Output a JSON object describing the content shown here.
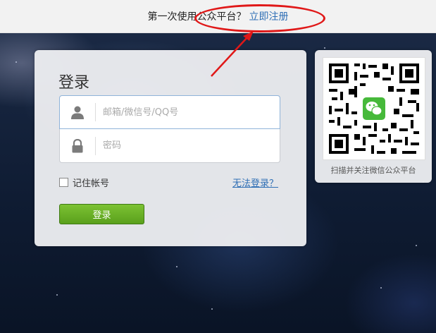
{
  "header": {
    "prompt": "第一次使用公众平台？",
    "register_link": "立即注册"
  },
  "login": {
    "title": "登录",
    "account_placeholder": "邮箱/微信号/QQ号",
    "password_placeholder": "密码",
    "remember_label": "记住帐号",
    "cant_login": "无法登录？",
    "submit_label": "登录",
    "icons": {
      "account": "user-icon",
      "password": "lock-icon"
    }
  },
  "qr": {
    "caption": "扫描并关注微信公众平台",
    "logo_icon": "wechat-logo-icon"
  },
  "annotation": {
    "color": "#e01818"
  },
  "colors": {
    "link": "#2f6fb5",
    "button_green": "#66ac24"
  }
}
